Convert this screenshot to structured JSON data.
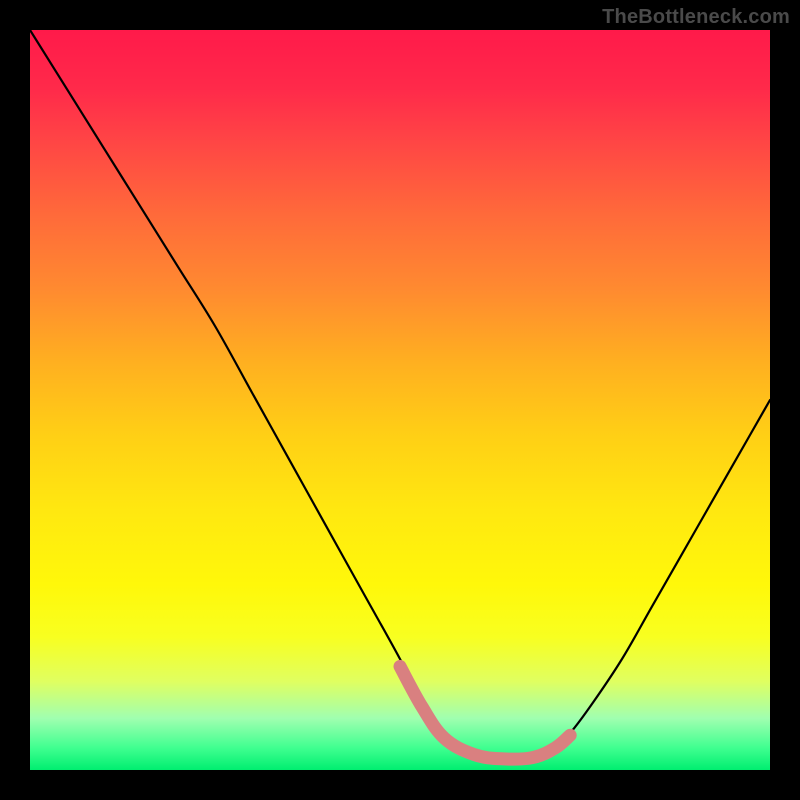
{
  "watermark": "TheBottleneck.com",
  "chart_data": {
    "type": "line",
    "title": "",
    "xlabel": "",
    "ylabel": "",
    "xlim": [
      0,
      100
    ],
    "ylim": [
      0,
      100
    ],
    "series": [
      {
        "name": "bottleneck-curve",
        "x": [
          0,
          5,
          10,
          15,
          20,
          25,
          30,
          35,
          40,
          45,
          50,
          53,
          56,
          60,
          64,
          68,
          71,
          73,
          76,
          80,
          84,
          88,
          92,
          96,
          100
        ],
        "values": [
          100,
          92,
          84,
          76,
          68,
          60,
          51,
          42,
          33,
          24,
          15,
          9,
          4.5,
          2.2,
          1.6,
          1.8,
          3.2,
          5,
          9,
          15,
          22,
          29,
          36,
          43,
          50
        ],
        "color": "#000000"
      },
      {
        "name": "optimal-band",
        "x": [
          50,
          53,
          56,
          60,
          64,
          68,
          71,
          73
        ],
        "values": [
          14,
          8.5,
          4.3,
          2.1,
          1.5,
          1.7,
          3.0,
          4.7
        ],
        "color": "#d98080"
      }
    ],
    "background_gradient": {
      "top": "#ff1a4a",
      "mid": "#ffe810",
      "bottom": "#00ee70"
    }
  }
}
